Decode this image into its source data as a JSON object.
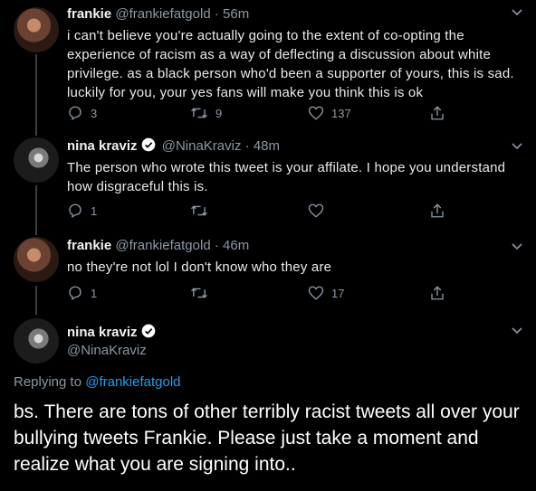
{
  "tweets": [
    {
      "name": "frankie",
      "handle": "@frankiefatgold",
      "sep": "·",
      "time": "56m",
      "verified": false,
      "text": "i can't believe you're actually going to the extent of co-opting the experience of racism as a way of deflecting a discussion about white privilege. as a black person who'd been a supporter of yours, this is sad. luckily for you, your yes fans will make you think this is ok",
      "replies": "3",
      "retweets": "9",
      "likes": "137"
    },
    {
      "name": "nina kraviz",
      "handle": "@NinaKraviz",
      "sep": "·",
      "time": "48m",
      "verified": true,
      "text": "The person who wrote this tweet is your affilate. I hope you understand how disgraceful this is.",
      "replies": "1",
      "retweets": "",
      "likes": ""
    },
    {
      "name": "frankie",
      "handle": "@frankiefatgold",
      "sep": "·",
      "time": "46m",
      "verified": false,
      "text": "no they're not lol I don't know who they are",
      "replies": "1",
      "retweets": "",
      "likes": "17"
    }
  ],
  "main_tweet": {
    "name": "nina kraviz",
    "handle": "@NinaKraviz",
    "verified": true,
    "replying_prefix": "Replying to",
    "replying_handle": "@frankiefatgold",
    "text": "bs. There are tons of other terribly racist tweets all over your bullying tweets Frankie. Please just take a moment and realize what you are signing into.."
  },
  "colors": {
    "background": "#000000",
    "text": "#e8eaed",
    "muted": "#8b98a5",
    "link": "#1da1f2",
    "verified": "#ffffff"
  },
  "icons": [
    "chevron-down-icon",
    "reply-icon",
    "retweet-icon",
    "like-icon",
    "share-icon",
    "verified-badge-icon"
  ]
}
